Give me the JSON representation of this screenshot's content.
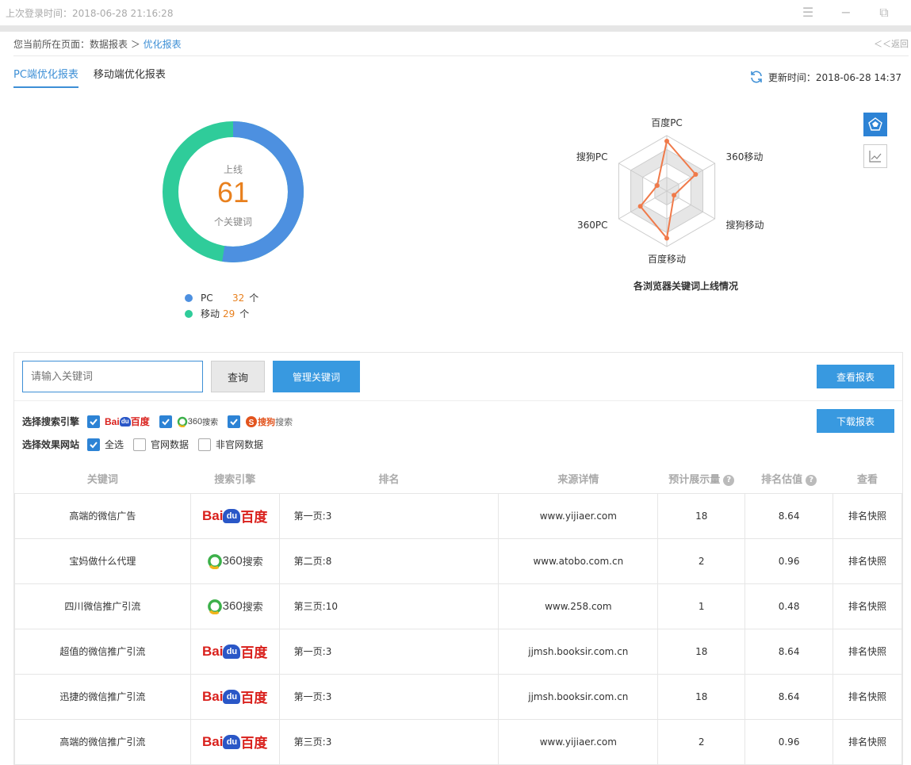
{
  "topbar": {
    "login_text": "上次登录时间：2018-06-28 21:16:28"
  },
  "breadcrumb": {
    "prefix": "您当前所在页面：数据报表 ＞ ",
    "current": "优化报表",
    "back": "＜＜返回"
  },
  "tabs": [
    {
      "label": "PC端优化报表"
    },
    {
      "label": "移动端优化报表"
    }
  ],
  "update": {
    "text": "更新时间：2018-06-28 14:37"
  },
  "donut": {
    "top_label": "上线",
    "total": "61",
    "bottom_label": "个关键词",
    "pc_fraction": 0.5246,
    "colors": {
      "pc": "#4d90e0",
      "mobile": "#2fcc9a"
    }
  },
  "legend": [
    {
      "name": "PC",
      "value": "32",
      "unit": "个"
    },
    {
      "name": "移动",
      "value": "29",
      "unit": "个"
    }
  ],
  "radar": {
    "axes": [
      "百度PC",
      "360移动",
      "搜狗移动",
      "百度移动",
      "360PC",
      "搜狗PC"
    ],
    "values": [
      0.9,
      0.6,
      0.15,
      0.85,
      0.55,
      0.2
    ],
    "title": "各浏览器关键词上线情况",
    "color": "#f07a4a"
  },
  "controls": {
    "search_placeholder": "请输入关键词",
    "query": "查询",
    "manage": "管理关键词",
    "view_report": "查看报表",
    "download_report": "下载报表"
  },
  "filters": {
    "engine_label": "选择搜索引擎",
    "site_label": "选择效果网站",
    "site_options": [
      {
        "label": "全选",
        "checked": true
      },
      {
        "label": "官网数据",
        "checked": false
      },
      {
        "label": "非官网数据",
        "checked": false
      }
    ],
    "engine_logos": {
      "baidu_a": "Bai",
      "baidu_b": "du",
      "baidu_c": "百度",
      "s360_a": "360",
      "s360_b": "搜索",
      "sogou_a": "搜狗",
      "sogou_b": "搜索"
    }
  },
  "table": {
    "headers": [
      "关键词",
      "搜索引擎",
      "排名",
      "来源详情",
      "预计展示量",
      "排名估值",
      "查看"
    ],
    "rows": [
      {
        "keyword": "高端的微信广告",
        "engine": "baidu",
        "rank": "第一页:3",
        "source": "www.yijiaer.com",
        "views": "18",
        "value": "8.64",
        "action": "排名快照"
      },
      {
        "keyword": "宝妈做什么代理",
        "engine": "360",
        "rank": "第二页:8",
        "source": "www.atobo.com.cn",
        "views": "2",
        "value": "0.96",
        "action": "排名快照"
      },
      {
        "keyword": "四川微信推广引流",
        "engine": "360",
        "rank": "第三页:10",
        "source": "www.258.com",
        "views": "1",
        "value": "0.48",
        "action": "排名快照"
      },
      {
        "keyword": "超值的微信推广引流",
        "engine": "baidu",
        "rank": "第一页:3",
        "source": "jjmsh.booksir.com.cn",
        "views": "18",
        "value": "8.64",
        "action": "排名快照"
      },
      {
        "keyword": "迅捷的微信推广引流",
        "engine": "baidu",
        "rank": "第一页:3",
        "source": "jjmsh.booksir.com.cn",
        "views": "18",
        "value": "8.64",
        "action": "排名快照"
      },
      {
        "keyword": "高端的微信推广引流",
        "engine": "baidu",
        "rank": "第三页:3",
        "source": "www.yijiaer.com",
        "views": "2",
        "value": "0.96",
        "action": "排名快照"
      }
    ]
  }
}
